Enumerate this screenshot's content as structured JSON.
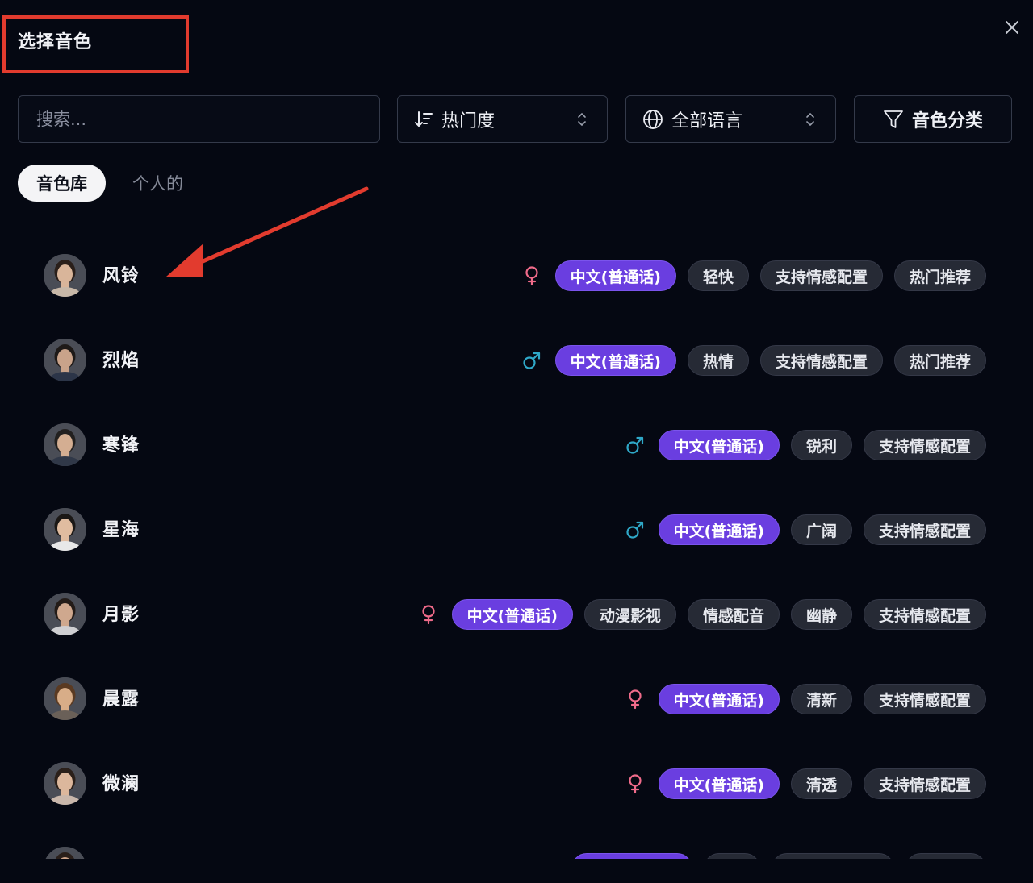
{
  "dialog": {
    "title": "选择音色"
  },
  "toolbar": {
    "search_placeholder": "搜索...",
    "search_value": "",
    "sort_label": "热门度",
    "language_label": "全部语言",
    "category_label": "音色分类"
  },
  "tabs": [
    {
      "label": "音色库",
      "active": true
    },
    {
      "label": "个人的",
      "active": false
    }
  ],
  "colors": {
    "accent": "#6a3ee0",
    "female": "#f06b8a",
    "male": "#2fa8c8",
    "annotation": "#e23b2e"
  },
  "voices": [
    {
      "name": "风铃",
      "gender": "female",
      "tags": [
        "中文(普通话)",
        "轻快",
        "支持情感配置",
        "热门推荐"
      ]
    },
    {
      "name": "烈焰",
      "gender": "male",
      "tags": [
        "中文(普通话)",
        "热情",
        "支持情感配置",
        "热门推荐"
      ]
    },
    {
      "name": "寒锋",
      "gender": "male",
      "tags": [
        "中文(普通话)",
        "锐利",
        "支持情感配置"
      ]
    },
    {
      "name": "星海",
      "gender": "male",
      "tags": [
        "中文(普通话)",
        "广阔",
        "支持情感配置"
      ]
    },
    {
      "name": "月影",
      "gender": "female",
      "tags": [
        "中文(普通话)",
        "动漫影视",
        "情感配音",
        "幽静",
        "支持情感配置"
      ]
    },
    {
      "name": "晨露",
      "gender": "female",
      "tags": [
        "中文(普通话)",
        "清新",
        "支持情感配置"
      ]
    },
    {
      "name": "微澜",
      "gender": "female",
      "tags": [
        "中文(普通话)",
        "清透",
        "支持情感配置"
      ]
    },
    {
      "name": "",
      "gender": "",
      "tags": []
    }
  ]
}
